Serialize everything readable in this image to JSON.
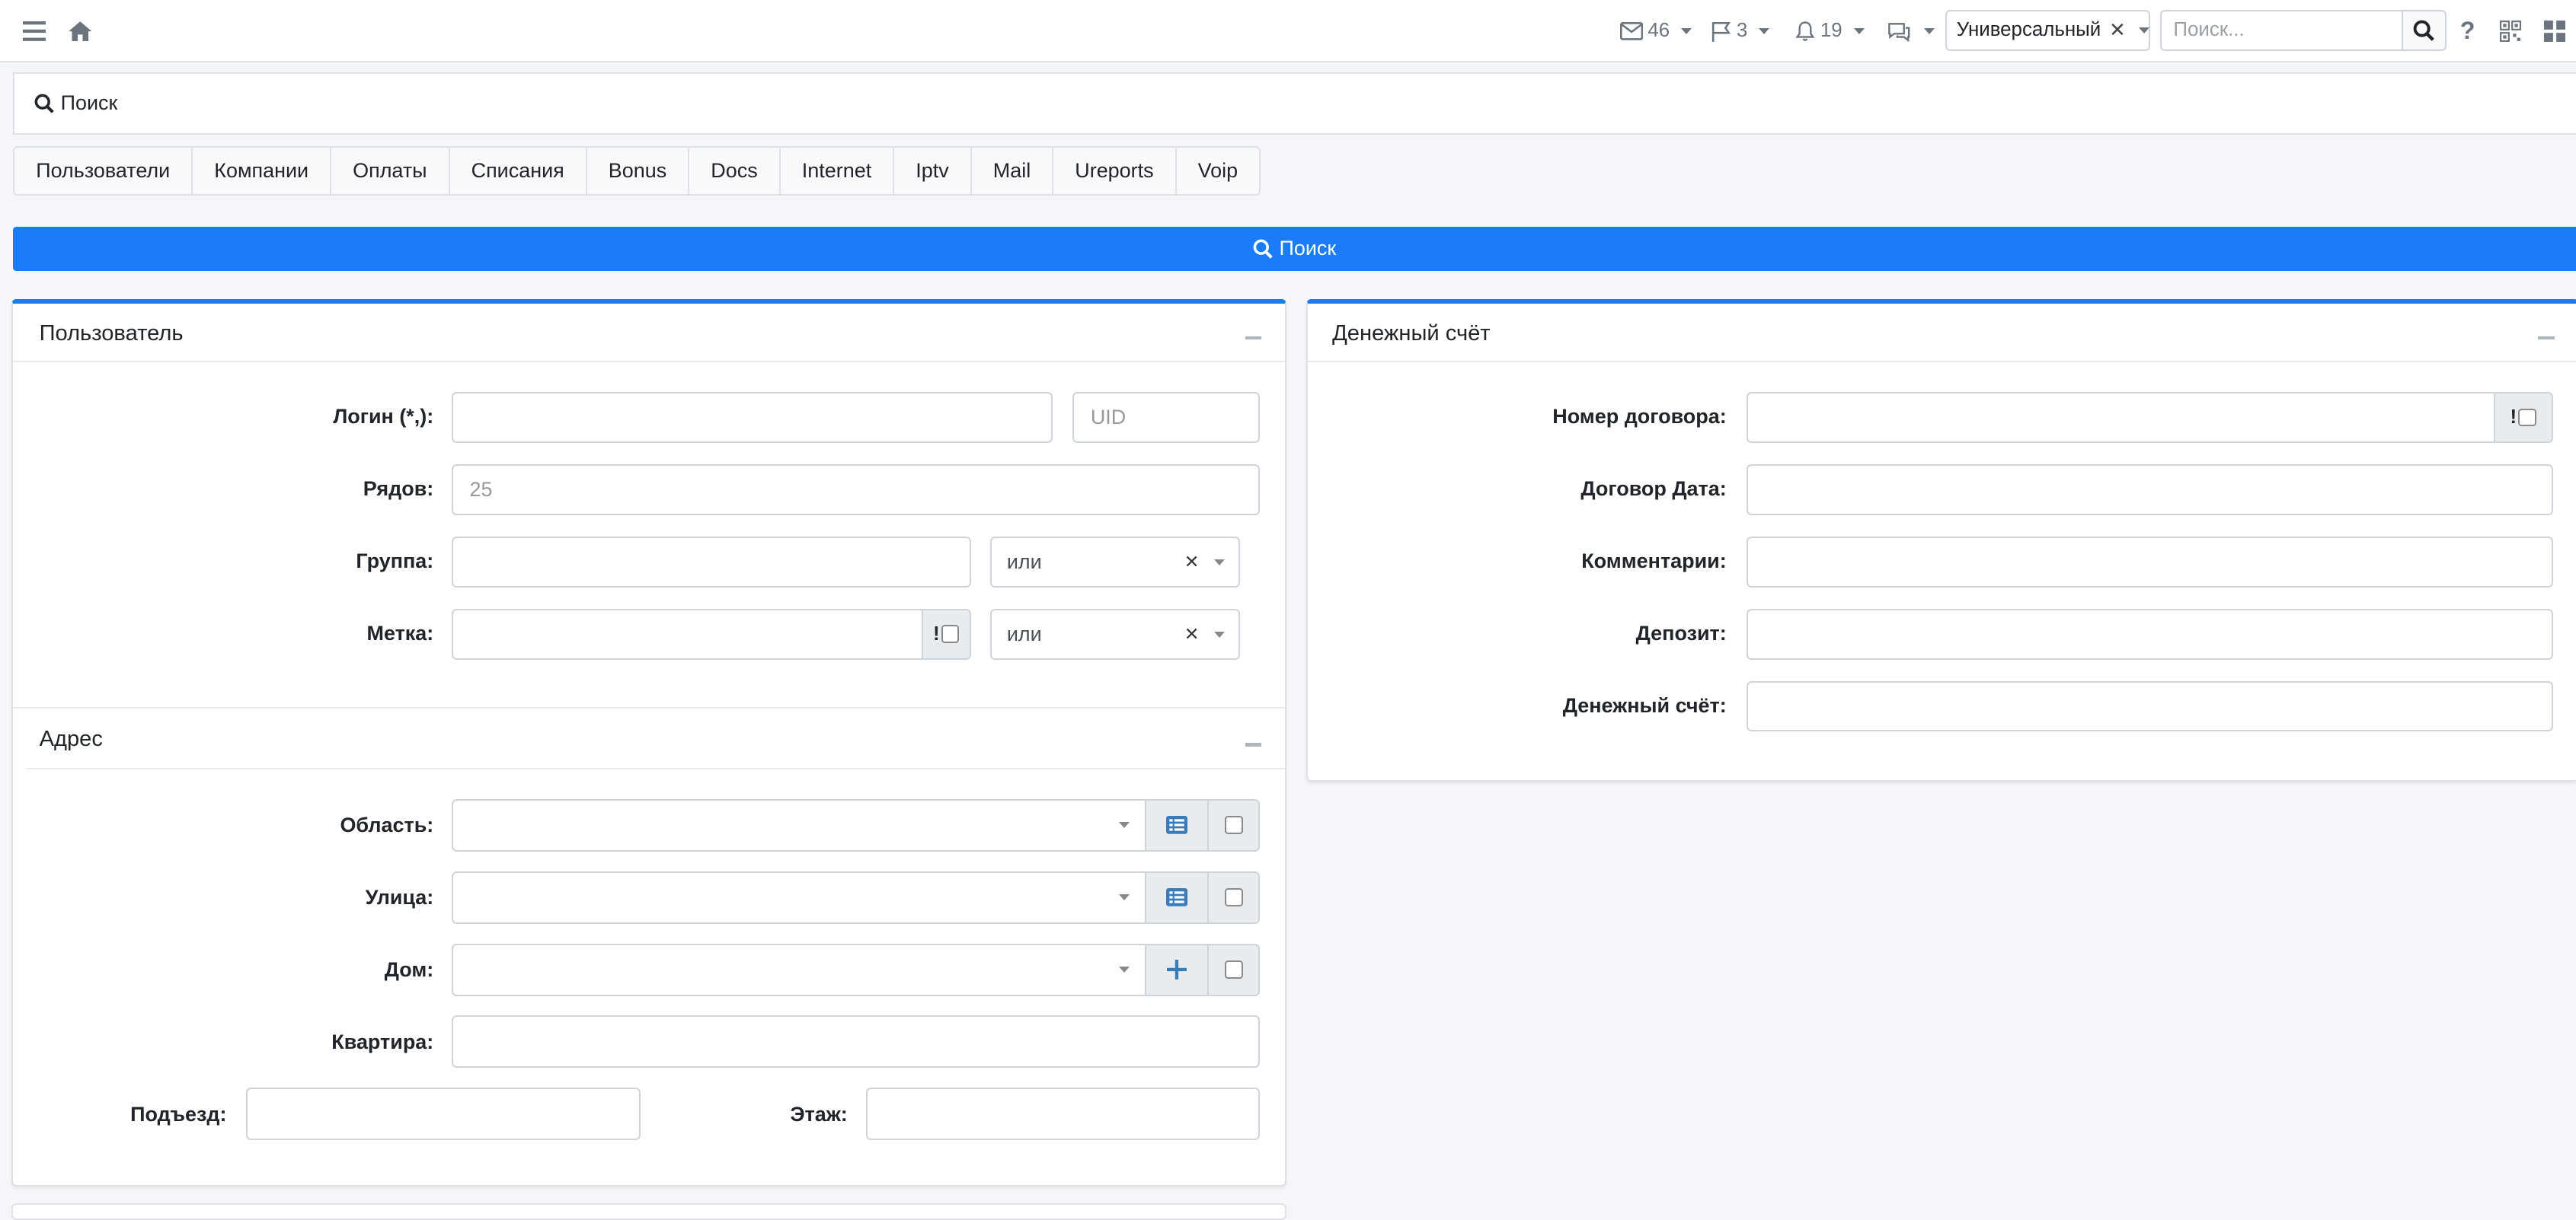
{
  "navbar": {
    "mail_count": "46",
    "flag_count": "3",
    "bell_count": "19",
    "profile_select": "Универсальный",
    "search_placeholder": "Поиск..."
  },
  "search_header": {
    "title": "Поиск"
  },
  "tabs": [
    {
      "label": "Пользователи"
    },
    {
      "label": "Компании"
    },
    {
      "label": "Оплаты"
    },
    {
      "label": "Списания"
    },
    {
      "label": "Bonus"
    },
    {
      "label": "Docs"
    },
    {
      "label": "Internet"
    },
    {
      "label": "Iptv"
    },
    {
      "label": "Mail"
    },
    {
      "label": "Ureports"
    },
    {
      "label": "Voip"
    }
  ],
  "search_button": {
    "label": "Поиск"
  },
  "user_panel": {
    "title": "Пользователь",
    "login_label": "Логин (*,):",
    "uid_placeholder": "UID",
    "rows_label": "Рядов:",
    "rows_placeholder": "25",
    "group_label": "Группа:",
    "group_logic": "или",
    "tag_label": "Метка:",
    "tag_logic": "или"
  },
  "address_panel": {
    "title": "Адрес",
    "region_label": "Область:",
    "street_label": "Улица:",
    "house_label": "Дом:",
    "apartment_label": "Квартира:",
    "entrance_label": "Подъезд:",
    "floor_label": "Этаж:"
  },
  "account_panel": {
    "title": "Денежный счёт",
    "contract_number_label": "Номер договора:",
    "contract_date_label": "Договор Дата:",
    "comments_label": "Комментарии:",
    "deposit_label": "Депозит:",
    "account_label": "Денежный счёт:"
  },
  "colors": {
    "primary": "#1a7cf8",
    "addon_icon": "#3a7bb8"
  }
}
